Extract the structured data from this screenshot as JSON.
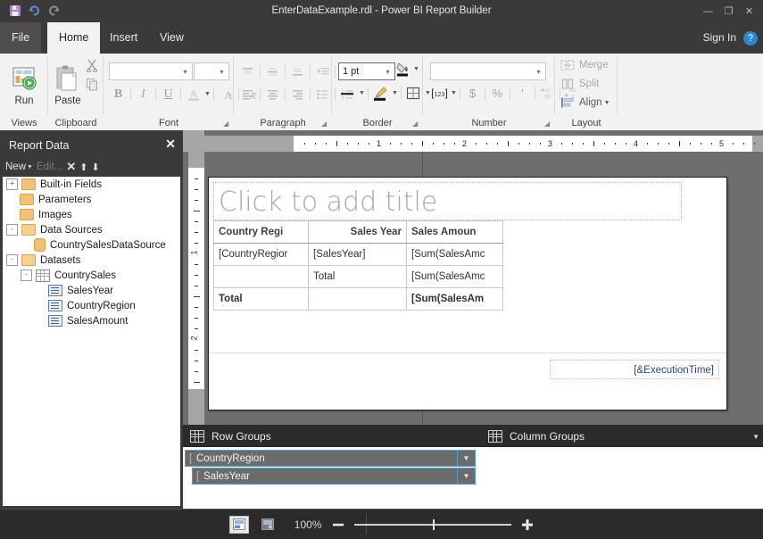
{
  "window": {
    "title": "EnterDataExample.rdl - Power BI Report Builder",
    "quick_access": [
      {
        "name": "save-icon",
        "glyph": "💾"
      },
      {
        "name": "undo-icon",
        "glyph": "↶"
      },
      {
        "name": "redo-icon",
        "glyph": "↷"
      }
    ],
    "controls": {
      "minimize": "—",
      "restore": "❐",
      "close": "✕"
    }
  },
  "tabs": {
    "file": "File",
    "items": [
      "Home",
      "Insert",
      "View"
    ],
    "active": "Home",
    "sign_in": "Sign In",
    "help": "?"
  },
  "ribbon": {
    "views": {
      "label": "Views",
      "run": "Run"
    },
    "clipboard": {
      "label": "Clipboard",
      "paste": "Paste",
      "cut": "✂",
      "copy": "❐"
    },
    "font": {
      "label": "Font",
      "family_value": "",
      "size_value": "",
      "bold": "B",
      "italic": "I",
      "underline": "U",
      "font_color": "A",
      "grow_font": "A",
      "shrink_font": "A"
    },
    "paragraph": {
      "label": "Paragraph",
      "align_top": "top-align",
      "align_middle": "middle-align",
      "align_bottom": "bottom-align",
      "decrease_indent": "decrease-indent",
      "increase_indent": "increase-indent",
      "align_left": "align-left",
      "align_center": "align-center",
      "align_right": "align-right",
      "bullets": "bullets",
      "numbering": "numbering"
    },
    "border": {
      "label": "Border",
      "width_value": "1 pt",
      "fill": "fill-color",
      "line_style": "line-style",
      "pen_color": "pen-color",
      "borders": "borders"
    },
    "number": {
      "label": "Number",
      "format_value": "",
      "placeholder_style": "[123]",
      "currency": "$",
      "percent": "%",
      "comma": "'",
      "increase_decimal": ".00",
      "decrease_decimal": ".00"
    },
    "layout": {
      "label": "Layout",
      "merge": "Merge",
      "split": "Split",
      "align": "Align"
    }
  },
  "report_data": {
    "title": "Report Data",
    "close": "✕",
    "toolbar": {
      "new": "New",
      "edit": "Edit...",
      "delete": "✕",
      "move_up": "⬆",
      "move_down": "⬇"
    },
    "tree": [
      {
        "label": "Built-in Fields",
        "type": "folder",
        "indent": 0,
        "expander": "+"
      },
      {
        "label": "Parameters",
        "type": "folder",
        "indent": 0,
        "expander": ""
      },
      {
        "label": "Images",
        "type": "folder",
        "indent": 0,
        "expander": ""
      },
      {
        "label": "Data Sources",
        "type": "folder-open",
        "indent": 0,
        "expander": "-"
      },
      {
        "label": "CountrySalesDataSource",
        "type": "datasource",
        "indent": 1,
        "expander": ""
      },
      {
        "label": "Datasets",
        "type": "folder-open",
        "indent": 0,
        "expander": "-"
      },
      {
        "label": "CountrySales",
        "type": "dataset",
        "indent": 1,
        "expander": "-"
      },
      {
        "label": "SalesYear",
        "type": "field",
        "indent": 2,
        "expander": ""
      },
      {
        "label": "CountryRegion",
        "type": "field",
        "indent": 2,
        "expander": ""
      },
      {
        "label": "SalesAmount",
        "type": "field",
        "indent": 2,
        "expander": ""
      }
    ]
  },
  "design": {
    "ruler": {
      "h_numbers": [
        "1",
        "2",
        "3",
        "4",
        "5"
      ],
      "v_numbers": [
        "1",
        "2"
      ]
    },
    "title_placeholder": "Click to add title",
    "table": {
      "headers": [
        "Country Regi",
        "Sales Year",
        "Sales Amoun"
      ],
      "rows": [
        [
          "[CountryRegior",
          "[SalesYear]",
          "[Sum(SalesAmc"
        ],
        [
          "",
          "Total",
          "[Sum(SalesAmc"
        ],
        [
          "Total",
          "",
          "[Sum(SalesAm"
        ]
      ]
    },
    "footer_expression": "[&ExecutionTime]"
  },
  "grouping": {
    "row_groups": {
      "title": "Row Groups",
      "items": [
        "CountryRegion",
        "SalesYear"
      ]
    },
    "column_groups": {
      "title": "Column Groups",
      "items": []
    },
    "menu_caret": "▼"
  },
  "status": {
    "zoom_label": "100%",
    "minus": "—",
    "plus": "➕",
    "design_view": "design-view",
    "print_layout": "print-layout-view"
  },
  "colors": {
    "chrome": "#3b3a39",
    "accent_blue": "#4f9fd4",
    "ribbon_bg": "#f2f2f2",
    "folder": "#f0c177",
    "save_icon": "#b07fd0"
  }
}
